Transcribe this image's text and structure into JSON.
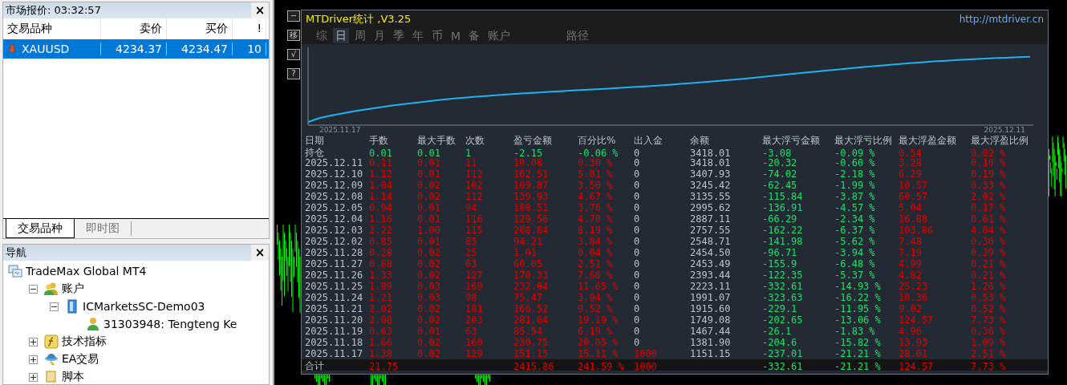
{
  "market_watch": {
    "title": "市场报价: 03:32:57",
    "close": "×",
    "columns": [
      "交易品种",
      "卖价",
      "买价",
      "!"
    ],
    "rows": [
      {
        "symbol": "XAUUSD",
        "bid": "4234.37",
        "ask": "4234.47",
        "spread": "10",
        "selected": true
      }
    ],
    "tabs": [
      {
        "label": "交易品种",
        "selected": true
      },
      {
        "label": "即时图",
        "selected": false
      }
    ]
  },
  "navigator": {
    "title": "导航",
    "close": "×",
    "tree": [
      {
        "label": "TradeMax Global MT4",
        "kind": "terminal",
        "children": [
          {
            "label": "账户",
            "kind": "accounts",
            "expanded": true,
            "children": [
              {
                "label": "ICMarketsSC-Demo03",
                "kind": "server",
                "expanded": true,
                "children": [
                  {
                    "label": "31303948: Tengteng Ke",
                    "kind": "user"
                  }
                ]
              }
            ]
          },
          {
            "label": "技术指标",
            "kind": "indicator",
            "expanded": false
          },
          {
            "label": "EA交易",
            "kind": "expert",
            "expanded": false
          },
          {
            "label": "脚本",
            "kind": "script",
            "expanded": false
          }
        ]
      }
    ]
  },
  "chart_buttons": [
    "−",
    "移",
    "√",
    "?"
  ],
  "stats_panel": {
    "title": "MTDriver统计 ,V3.25",
    "link": "http://mtdriver.cn",
    "periods": [
      {
        "label": "综",
        "selected": false
      },
      {
        "label": "日",
        "selected": true
      },
      {
        "label": "周",
        "selected": false
      },
      {
        "label": "月",
        "selected": false
      },
      {
        "label": "季",
        "selected": false
      },
      {
        "label": "年",
        "selected": false
      },
      {
        "label": "币",
        "selected": false
      },
      {
        "label": "M",
        "selected": false
      },
      {
        "label": "备",
        "selected": false
      },
      {
        "label": "账户",
        "selected": false
      },
      {
        "label": "路径",
        "selected": false
      }
    ],
    "equity_start": "2025.11.17",
    "equity_end": "2025.12.11",
    "columns": [
      "日期",
      "手数",
      "最大手数",
      "次数",
      "盈亏金额",
      "百分比%",
      "出入金",
      "余额",
      "最大浮亏金额",
      "最大浮亏比例",
      "最大浮盈金额",
      "最大浮盈比例"
    ],
    "rows": [
      {
        "kind": "open",
        "cells": [
          "持仓",
          "0.01",
          "0.01",
          "1",
          "-2.15",
          "-0.06 %",
          "0",
          "3418.01",
          "-3.08",
          "-0.09 %",
          "0.54",
          "0.02 %"
        ]
      },
      {
        "kind": "day",
        "cells": [
          "2025.12.11",
          "0.11",
          "0.01",
          "11",
          "10.08",
          "0.30 %",
          "0",
          "3418.01",
          "-20.32",
          "-0.60 %",
          "3.28",
          "0.10 %"
        ]
      },
      {
        "kind": "day",
        "cells": [
          "2025.12.10",
          "1.12",
          "0.01",
          "112",
          "162.51",
          "5.01 %",
          "0",
          "3407.93",
          "-74.02",
          "-2.18 %",
          "6.29",
          "0.19 %"
        ]
      },
      {
        "kind": "day",
        "cells": [
          "2025.12.09",
          "1.04",
          "0.02",
          "102",
          "109.87",
          "3.50 %",
          "0",
          "3245.42",
          "-62.45",
          "-1.99 %",
          "10.57",
          "0.33 %"
        ]
      },
      {
        "kind": "day",
        "cells": [
          "2025.12.08",
          "1.14",
          "0.02",
          "112",
          "139.93",
          "4.67 %",
          "0",
          "3135.55",
          "-115.84",
          "-3.87 %",
          "60.57",
          "2.02 %"
        ]
      },
      {
        "kind": "day",
        "cells": [
          "2025.12.05",
          "0.94",
          "0.01",
          "94",
          "108.51",
          "3.76 %",
          "0",
          "2995.62",
          "-136.91",
          "-4.57 %",
          "5.04",
          "0.17 %"
        ]
      },
      {
        "kind": "day",
        "cells": [
          "2025.12.04",
          "1.16",
          "0.01",
          "116",
          "129.56",
          "4.70 %",
          "0",
          "2887.11",
          "-66.29",
          "-2.34 %",
          "16.88",
          "0.61 %"
        ]
      },
      {
        "kind": "day",
        "cells": [
          "2025.12.03",
          "2.22",
          "1.00",
          "115",
          "208.84",
          "8.19 %",
          "0",
          "2757.55",
          "-162.22",
          "-6.37 %",
          "103.86",
          "4.04 %"
        ]
      },
      {
        "kind": "day",
        "cells": [
          "2025.12.02",
          "0.85",
          "0.01",
          "85",
          "94.21",
          "3.84 %",
          "0",
          "2548.71",
          "-141.98",
          "-5.62 %",
          "7.48",
          "0.30 %"
        ]
      },
      {
        "kind": "day",
        "cells": [
          "2025.11.28",
          "0.28",
          "0.02",
          "25",
          "1.01",
          "0.04 %",
          "0",
          "2454.50",
          "-96.71",
          "-3.94 %",
          "7.19",
          "0.29 %"
        ]
      },
      {
        "kind": "day",
        "cells": [
          "2025.11.27",
          "0.68",
          "0.02",
          "63",
          "60.05",
          "2.51 %",
          "0",
          "2453.49",
          "-155.9",
          "-6.48 %",
          "4.99",
          "0.21 %"
        ]
      },
      {
        "kind": "day",
        "cells": [
          "2025.11.26",
          "1.33",
          "0.02",
          "127",
          "170.33",
          "7.66 %",
          "0",
          "2393.44",
          "-122.35",
          "-5.37 %",
          "4.82",
          "0.21 %"
        ]
      },
      {
        "kind": "day",
        "cells": [
          "2025.11.25",
          "1.89",
          "0.03",
          "169",
          "232.04",
          "11.65 %",
          "0",
          "2223.11",
          "-332.61",
          "-14.93 %",
          "25.23",
          "1.26 %"
        ]
      },
      {
        "kind": "day",
        "cells": [
          "2025.11.24",
          "1.21",
          "0.03",
          "98",
          "75.47",
          "3.94 %",
          "0",
          "1991.07",
          "-323.63",
          "-16.22 %",
          "10.36",
          "0.53 %"
        ]
      },
      {
        "kind": "day",
        "cells": [
          "2025.11.21",
          "2.02",
          "0.02",
          "181",
          "166.52",
          "9.52 %",
          "0",
          "1915.60",
          "-229.1",
          "-11.95 %",
          "9.02",
          "0.52 %"
        ]
      },
      {
        "kind": "day",
        "cells": [
          "2025.11.20",
          "2.08",
          "0.02",
          "203",
          "281.64",
          "19.19 %",
          "0",
          "1749.08",
          "-202.65",
          "-13.06 %",
          "124.57",
          "7.73 %"
        ]
      },
      {
        "kind": "day",
        "cells": [
          "2025.11.19",
          "0.63",
          "0.01",
          "63",
          "85.54",
          "6.19 %",
          "0",
          "1467.44",
          "-26.1",
          "-1.83 %",
          "4.96",
          "0.36 %"
        ]
      },
      {
        "kind": "day",
        "cells": [
          "2025.11.18",
          "1.66",
          "0.02",
          "160",
          "230.75",
          "20.05 %",
          "0",
          "1381.90",
          "-204.6",
          "-15.82 %",
          "13.93",
          "1.09 %"
        ]
      },
      {
        "kind": "deposit",
        "cells": [
          "2025.11.17",
          "1.38",
          "0.02",
          "129",
          "151.15",
          "15.11 %",
          "1000",
          "1151.15",
          "-237.01",
          "-21.21 %",
          "28.01",
          "2.51 %"
        ]
      },
      {
        "kind": "total",
        "cells": [
          "合计",
          "21.75",
          "",
          "",
          "2415.86",
          "241.59 %",
          "1000",
          "",
          "-332.61",
          "-21.21 %",
          "124.57",
          "7.73 %"
        ]
      }
    ]
  }
}
